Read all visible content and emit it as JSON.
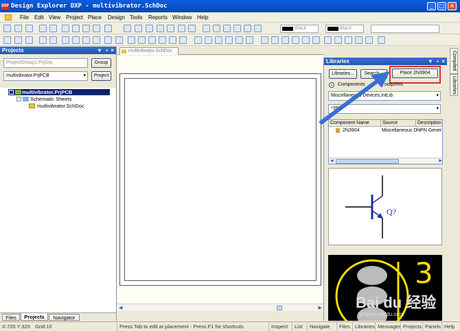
{
  "window": {
    "title": "Design Explorer DXP - multivibrator.SchDoc",
    "logo": "DXP"
  },
  "menu": [
    "File",
    "Edit",
    "View",
    "Project",
    "Place",
    "Design",
    "Tools",
    "Reports",
    "Window",
    "Help"
  ],
  "toolbar": {
    "color1": "Black",
    "color2": "Black"
  },
  "projects_panel": {
    "title": "Projects",
    "workspace_field": "ProjectGroup1.PrjGrp",
    "group_button": "Group",
    "project_select": "multivibrator.PrjPCB",
    "project_button": "Project",
    "tree": [
      {
        "label": "multivibrator.PrjPCB",
        "level": 0,
        "selected": true
      },
      {
        "label": "Schematic Sheets",
        "level": 1,
        "selected": false
      },
      {
        "label": "multivibrator.SchDoc",
        "level": 2,
        "selected": false
      }
    ],
    "bottom_tabs": [
      "Files",
      "Projects",
      "Navigator"
    ]
  },
  "document": {
    "tab": "multivibrator.SchDoc"
  },
  "libraries_panel": {
    "title": "Libraries",
    "libraries_button": "Libraries...",
    "search_button": "Search...",
    "place_button": "Place 2N3904",
    "radio_components": "Components",
    "radio_footprints": "ootprints",
    "library_select": "Miscellaneous Devices.IntLib",
    "filter": "*390",
    "table": {
      "headers": [
        "Component Name",
        "Source",
        "Description"
      ],
      "rows": [
        [
          "2N3904",
          "Miscellaneous D",
          "NPN Gener"
        ]
      ]
    },
    "symbol_designator": "Q?",
    "footprint_number": "3"
  },
  "right_side_tabs": [
    "Compiled",
    "Libraries"
  ],
  "watermark": {
    "text": "Bai du 经验",
    "url": "jingyan.baidu.com"
  },
  "status": {
    "coords": "X:720 Y:320",
    "grid": "Grid:10",
    "message": "Press Tab to edit at placement - Press F1 for shortcuts",
    "tabs": [
      "Inspect",
      "List",
      "Navigate",
      "Files",
      "Libraries",
      "Messages",
      "Projects",
      "Panels",
      "Help"
    ]
  },
  "colors": {
    "accent": "#2653b0",
    "highlight": "#d9302c",
    "selection": "#0a246a",
    "symbol": "#1a2fa8",
    "footprint": "#f0e000"
  }
}
